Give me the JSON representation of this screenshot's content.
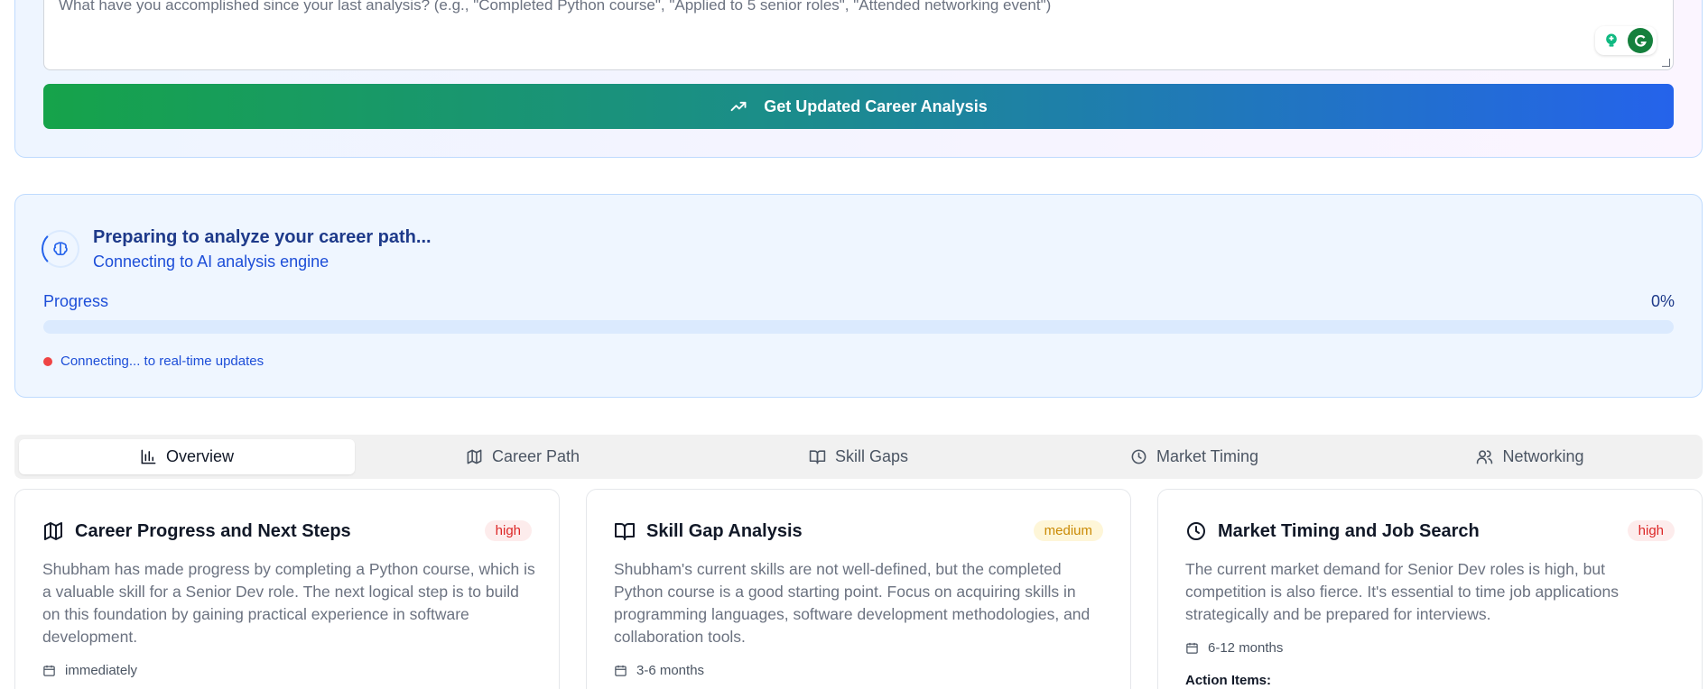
{
  "update_form": {
    "textarea_placeholder": "What have you accomplished since your last analysis? (e.g., \"Completed Python course\", \"Applied to 5 senior roles\", \"Attended networking event\")",
    "analyze_button_label": "Get Updated Career Analysis",
    "analyze_button_icon": "trending-up-icon",
    "gradient_colors": [
      "#16a34a",
      "#2563eb"
    ]
  },
  "progress": {
    "icon": "brain-icon",
    "title": "Preparing to analyze your career path...",
    "subtitle": "Connecting to AI analysis engine",
    "label": "Progress",
    "percent_text": "0%",
    "percent_value": 0,
    "status_text": "Connecting... to real-time updates",
    "status_color": "#ef4444"
  },
  "tabs": [
    {
      "label": "Overview",
      "icon": "bar-chart-icon",
      "active": true
    },
    {
      "label": "Career Path",
      "icon": "map-icon",
      "active": false
    },
    {
      "label": "Skill Gaps",
      "icon": "book-open-icon",
      "active": false
    },
    {
      "label": "Market Timing",
      "icon": "clock-icon",
      "active": false
    },
    {
      "label": "Networking",
      "icon": "users-icon",
      "active": false
    }
  ],
  "cards": [
    {
      "icon": "map-icon",
      "title": "Career Progress and Next Steps",
      "priority": "high",
      "description": "Shubham has made progress by completing a Python course, which is a valuable skill for a Senior Dev role. The next logical step is to build on this foundation by gaining practical experience in software development.",
      "timeframe": "immediately"
    },
    {
      "icon": "book-open-icon",
      "title": "Skill Gap Analysis",
      "priority": "medium",
      "description": "Shubham's current skills are not well-defined, but the completed Python course is a good starting point. Focus on acquiring skills in programming languages, software development methodologies, and collaboration tools.",
      "timeframe": "3-6 months"
    },
    {
      "icon": "clock-icon",
      "title": "Market Timing and Job Search",
      "priority": "high",
      "description": "The current market demand for Senior Dev roles is high, but competition is also fierce. It's essential to time job applications strategically and be prepared for interviews.",
      "timeframe": "6-12 months",
      "action_items_label": "Action Items:"
    }
  ]
}
